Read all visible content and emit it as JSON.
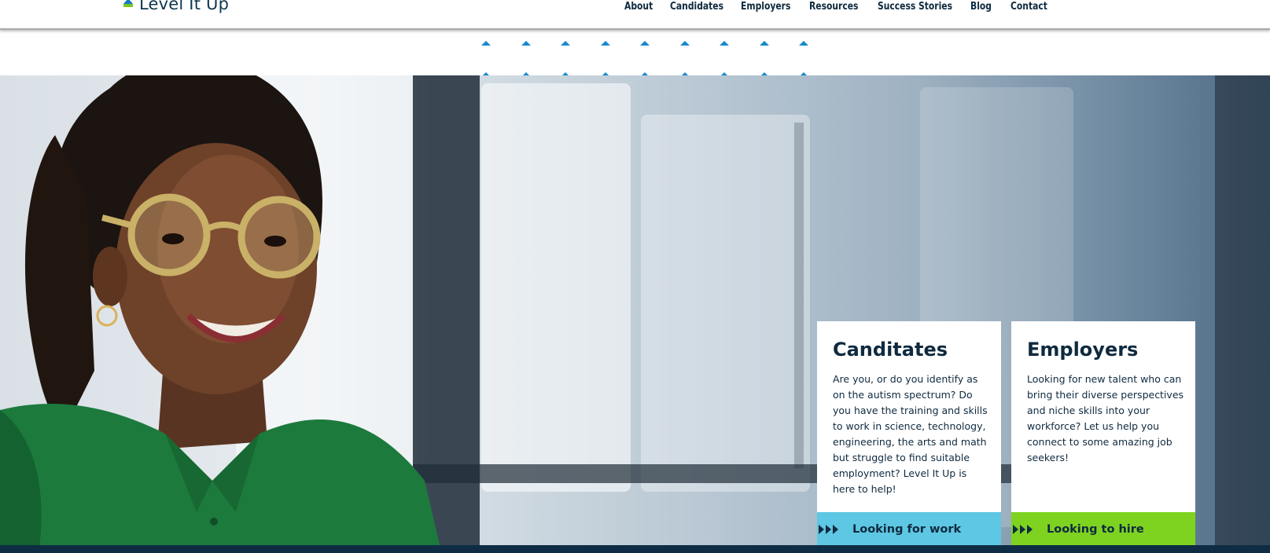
{
  "header": {
    "logo_text": "Level It Up",
    "nav": [
      "About",
      "Candidates",
      "Employers",
      "Resources",
      "Success Stories",
      "Blog",
      "Contact"
    ]
  },
  "colors": {
    "brand_navy": "#0f2a3f",
    "brand_blue": "#1789cf",
    "cta_blue": "#5ec7e3",
    "cta_green": "#7ed321"
  },
  "cards": {
    "candidates": {
      "title": "Canditates",
      "body": "Are you, or do you identify as on the autism spectrum? Do you have the training and skills to work in science, technology, engineering, the arts and math but struggle to find suitable employment? Level It Up is here to help!",
      "cta": "Looking for work",
      "cta_icon": "triple-chevron-right-icon"
    },
    "employers": {
      "title": "Employers",
      "body": "Looking for new talent who can bring their diverse perspectives and niche skills into your workforce? Let us help you connect to some amazing job seekers!",
      "cta": "Looking to hire",
      "cta_icon": "triple-chevron-right-icon"
    }
  }
}
